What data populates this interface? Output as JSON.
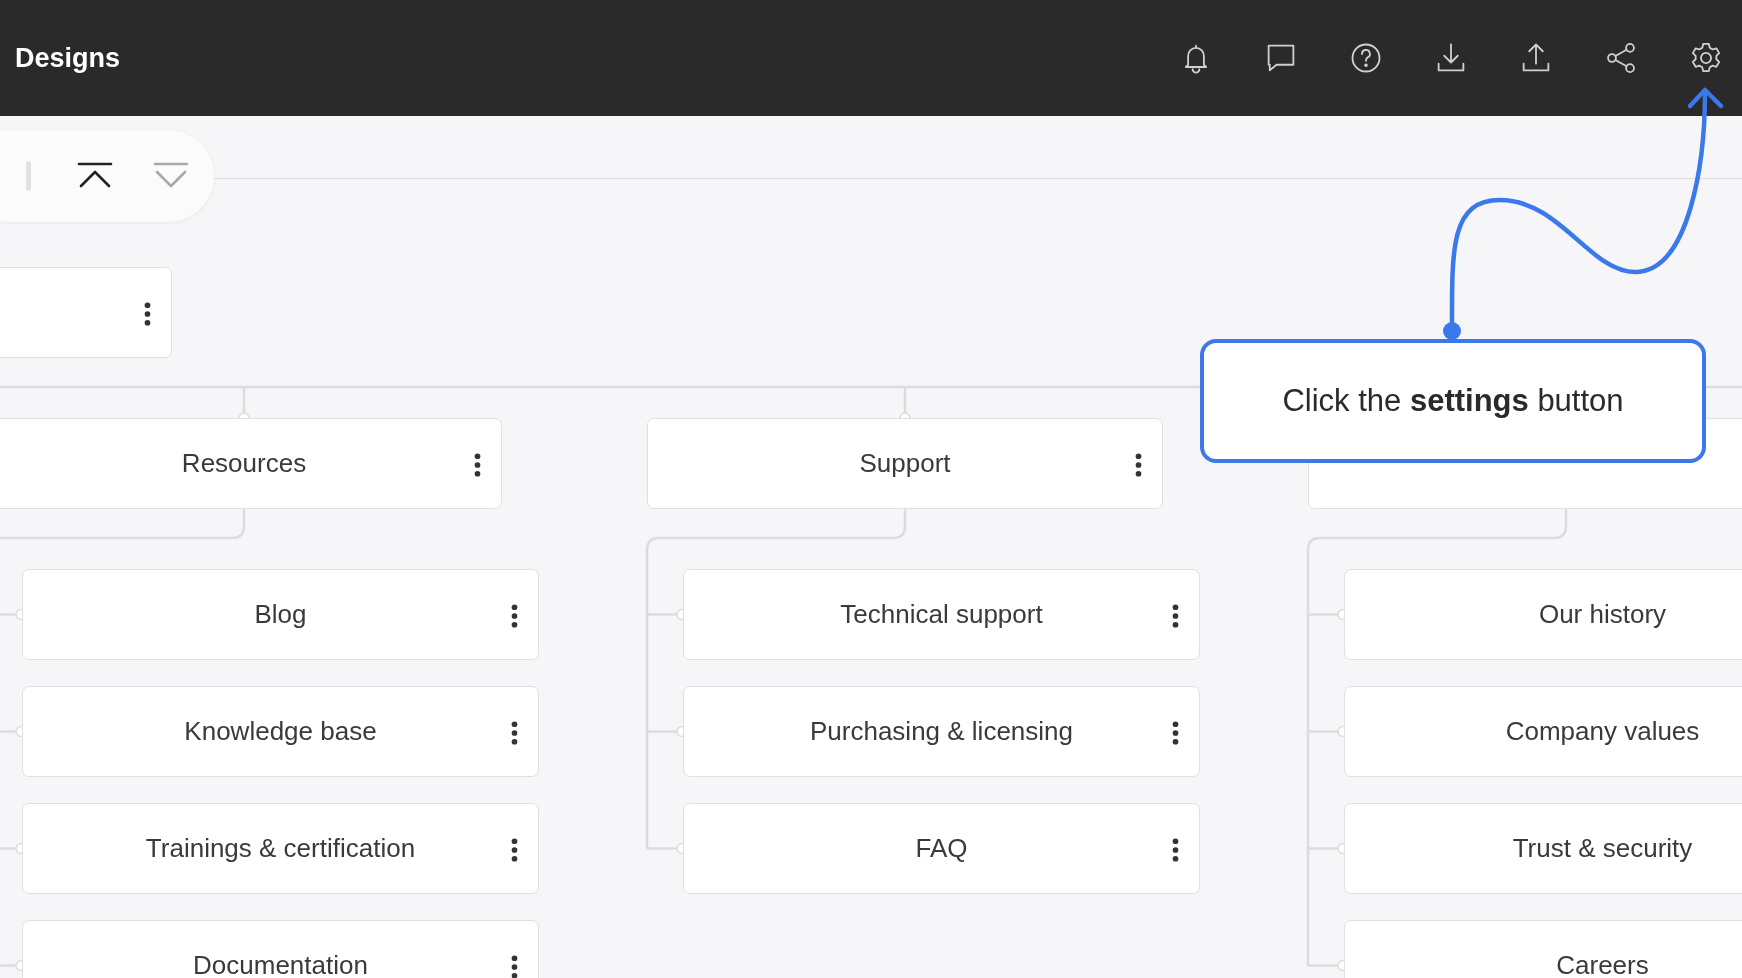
{
  "header": {
    "title": "Designs",
    "icons": [
      {
        "kind": "bell"
      },
      {
        "kind": "chat"
      },
      {
        "kind": "help"
      },
      {
        "kind": "download"
      },
      {
        "kind": "upload"
      },
      {
        "kind": "share"
      },
      {
        "kind": "settings"
      }
    ]
  },
  "toolbar": {
    "buttons": [
      {
        "kind": "collapse",
        "disabled": false
      },
      {
        "kind": "expand",
        "disabled": true
      }
    ]
  },
  "sitemap": {
    "root": {
      "children": [
        {
          "label": "Resources",
          "children": [
            {
              "label": "Blog"
            },
            {
              "label": "Knowledge base"
            },
            {
              "label": "Trainings & certification"
            },
            {
              "label": "Documentation"
            }
          ]
        },
        {
          "label": "Support",
          "children": [
            {
              "label": "Technical support"
            },
            {
              "label": "Purchasing & licensing"
            },
            {
              "label": "FAQ"
            }
          ]
        },
        {
          "children": [
            {
              "label": "Our history"
            },
            {
              "label": "Company values"
            },
            {
              "label": "Trust & security"
            },
            {
              "label": "Careers"
            }
          ]
        }
      ]
    }
  },
  "callout": {
    "text": "Click the **settings** button"
  }
}
